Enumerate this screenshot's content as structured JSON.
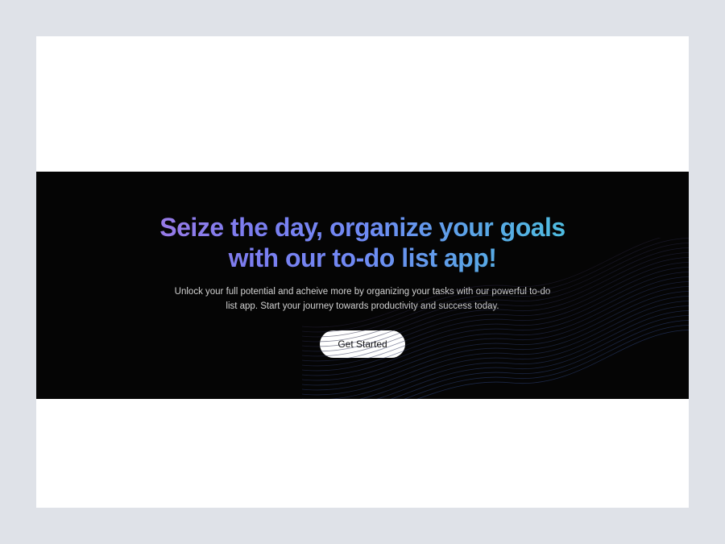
{
  "hero": {
    "title": "Seize the day, organize your goals with our to-do list app!",
    "subtitle": "Unlock your full potential and acheive more by organizing your tasks with our powerful to-do list app. Start your journey towards productivity and success today.",
    "cta_label": "Get Started"
  }
}
